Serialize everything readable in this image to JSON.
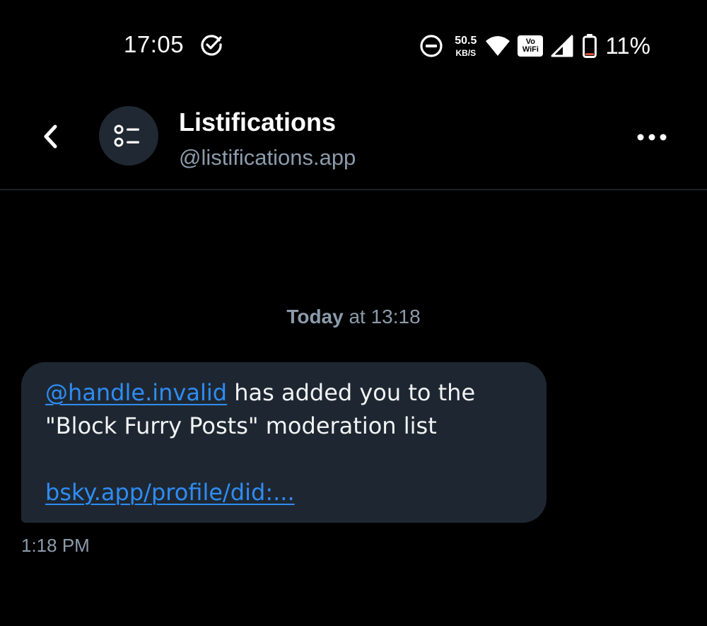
{
  "status_bar": {
    "time": "17:05",
    "net_speed_value": "50.5",
    "net_speed_unit": "KB/S",
    "vowifi_line1": "Vo",
    "vowifi_line2": "WiFi",
    "battery_percent": "11%",
    "battery_level": 0.11,
    "icons": [
      "check-circle-icon",
      "do-not-disturb-icon",
      "wifi-icon",
      "vowifi-icon",
      "cell-signal-icon",
      "battery-icon"
    ]
  },
  "header": {
    "name": "Listifications",
    "handle": "@listifications.app",
    "icons": [
      "back-chevron-icon",
      "list-avatar-icon",
      "more-dots-icon"
    ]
  },
  "conversation": {
    "date_day": "Today",
    "date_rest": " at 13:18",
    "message": {
      "mention": "@handle.invalid",
      "text_after_mention": " has added you to the",
      "line2": "\"Block Furry Posts\" moderation list",
      "link": "bsky.app/profile/did:..."
    },
    "message_time": "1:18 PM"
  },
  "colors": {
    "background": "#000000",
    "bubble": "#1e2731",
    "link": "#2e8cf5",
    "muted_text": "#8c9bab",
    "battery_low": "#e5533d"
  }
}
